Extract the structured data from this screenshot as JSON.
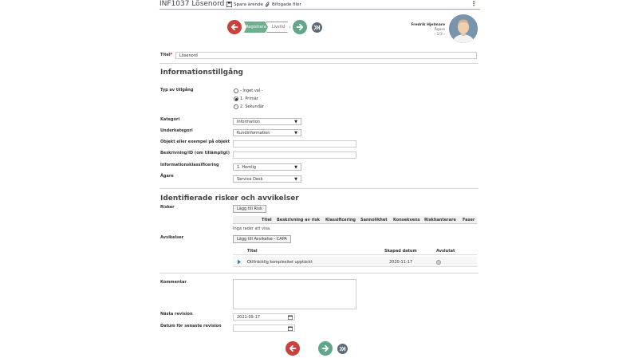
{
  "header": {
    "case_title": "INF1037 Lösenord",
    "save_label": "Spara ärende",
    "attach_label": "Bifogade filer"
  },
  "workflow": {
    "active_step": "Registrera",
    "next_step": "Livstid"
  },
  "user": {
    "name": "Fredrik Hjelmare",
    "role": "Ägare",
    "pager": "1/3"
  },
  "form": {
    "title_label": "Titel",
    "title_required": "*",
    "title_value": "Lösenord",
    "section_info": "Informationstillgång",
    "type_label": "Typ av tillgång",
    "type_options": [
      "- Inget val -",
      "1. Primär",
      "2. Sekundär"
    ],
    "category_label": "Kategori",
    "category_value": "Information",
    "subcategory_label": "Underkategori",
    "subcategory_value": "Kundinformation",
    "object_label": "Objekt eller exempel på objekt",
    "object_value": "",
    "description_label": "Beskrivning/ID (om tillämpligt)",
    "description_value": "",
    "classification_label": "Informationsklassificering",
    "classification_value": "1. Hemlig",
    "owner_label": "Ägare",
    "owner_value": "Service Desk"
  },
  "risks": {
    "section_title": "Identifierade risker och avvikelser",
    "risks_label": "Risker",
    "add_risk_button": "Lägg till Risk",
    "columns": [
      "Titel",
      "Beskrivning av risk",
      "Klassificering",
      "Sannolikhet",
      "Konsekvens",
      "Riskhanterare",
      "Faser"
    ],
    "empty_text": "Inga rader att visa."
  },
  "deviations": {
    "label": "Avvikelser",
    "add_button": "Lägg till Avvikelse - CAPA",
    "columns": [
      "Titel",
      "Skapad datum",
      "Avslutat"
    ],
    "rows": [
      {
        "title": "Otillräcklig komplexitet upptäckt",
        "created": "2020-11-17"
      }
    ]
  },
  "comment": {
    "label": "Kommentar",
    "value": ""
  },
  "revision": {
    "next_label": "Nästa revision",
    "next_value": "2021-05-17",
    "last_label": "Datum för senaste revision",
    "last_value": ""
  },
  "icons": {
    "back": "arrow-left-icon",
    "forward": "arrow-right-icon",
    "skip": "skip-forward-icon",
    "save": "floppy-disk-icon",
    "attach": "paperclip-icon",
    "calendar": "calendar-icon",
    "more": "kebab-menu-icon"
  },
  "colors": {
    "accent_green": "#5fa68b",
    "back_red": "#c9413a",
    "skip_grey": "#5c6b7a",
    "header_underline": "#8bc34a"
  }
}
